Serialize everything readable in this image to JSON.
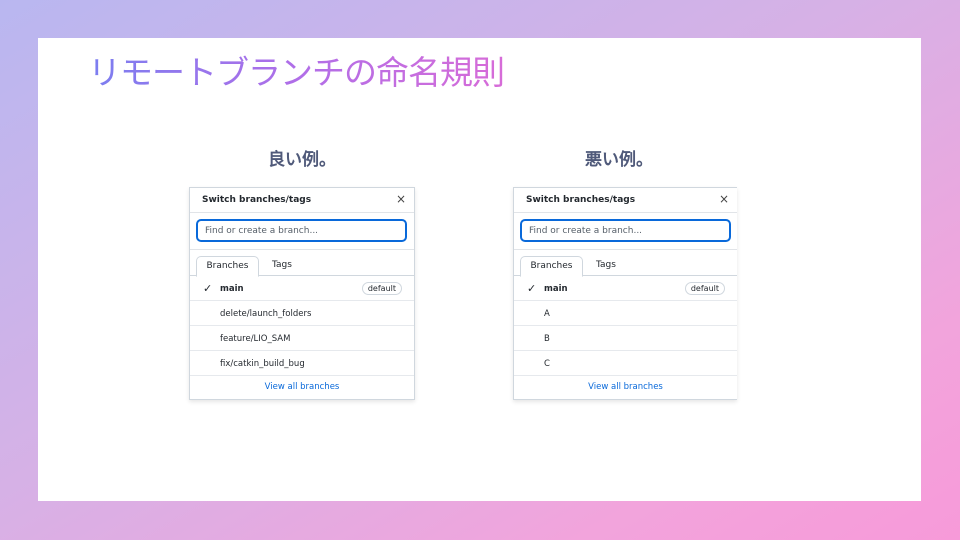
{
  "slide": {
    "title": "リモートブランチの命名規則",
    "good_caption": "良い例。",
    "bad_caption": "悪い例。"
  },
  "good_panel": {
    "header": "Switch branches/tags",
    "close": "×",
    "search_placeholder": "Find or create a branch...",
    "tabs": [
      "Branches",
      "Tags"
    ],
    "branches": [
      {
        "name": "main",
        "badge": "default"
      },
      {
        "name": "delete/launch_folders"
      },
      {
        "name": "feature/LIO_SAM"
      },
      {
        "name": "fix/catkin_build_bug"
      }
    ],
    "footer": "View all branches"
  },
  "bad_panel": {
    "header": "Switch branches/tags",
    "close": "×",
    "search_placeholder": "Find or create a branch...",
    "tabs": [
      "Branches",
      "Tags"
    ],
    "branches": [
      {
        "name": "main",
        "badge": "default"
      },
      {
        "name": "A"
      },
      {
        "name": "B"
      },
      {
        "name": "C"
      }
    ],
    "footer": "View all branches"
  },
  "icons": {
    "check": "check-icon",
    "close": "close-icon"
  },
  "colors": {
    "accent": "#0969da",
    "title_start": "#7b7ef0",
    "title_end": "#d76cd8",
    "caption": "#505a7a"
  }
}
